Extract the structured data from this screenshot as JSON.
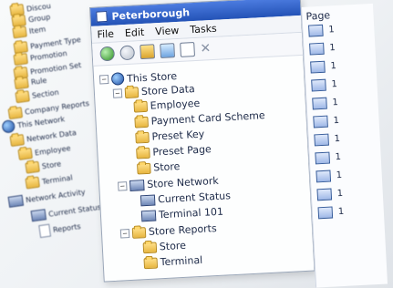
{
  "left_tree": {
    "items": [
      {
        "label": "Discou",
        "icon": "folder-icon"
      },
      {
        "label": "Group",
        "icon": "folder-icon"
      },
      {
        "label": "Item",
        "icon": "folder-icon"
      },
      {
        "label": "Payment Type",
        "icon": "folder-icon"
      },
      {
        "label": "Promotion",
        "icon": "folder-icon"
      },
      {
        "label": "Promotion Set",
        "icon": "folder-icon"
      },
      {
        "label": "Rule",
        "icon": "folder-icon"
      },
      {
        "label": "Section",
        "icon": "folder-icon"
      },
      {
        "label": "Company Reports",
        "icon": "folder-icon"
      },
      {
        "label": "This Network",
        "icon": "globe-icon"
      },
      {
        "label": "Network Data",
        "icon": "folder-icon"
      },
      {
        "label": "Employee",
        "icon": "folder-icon"
      },
      {
        "label": "Store",
        "icon": "folder-icon"
      },
      {
        "label": "Terminal",
        "icon": "folder-icon"
      },
      {
        "label": "Network Activity",
        "icon": "network-icon"
      },
      {
        "label": "Current Status",
        "icon": "network-icon"
      },
      {
        "label": "Reports",
        "icon": "document-icon"
      }
    ]
  },
  "window": {
    "title": "Peterborough",
    "menu": [
      "File",
      "Edit",
      "View",
      "Tasks"
    ],
    "tree": [
      {
        "label": "This Store",
        "icon": "globe-icon"
      },
      {
        "label": "Store Data",
        "icon": "folder-icon"
      },
      {
        "label": "Employee",
        "icon": "folder-icon"
      },
      {
        "label": "Payment Card Scheme",
        "icon": "folder-icon"
      },
      {
        "label": "Preset Key",
        "icon": "folder-icon"
      },
      {
        "label": "Preset Page",
        "icon": "folder-icon"
      },
      {
        "label": "Store",
        "icon": "folder-icon"
      },
      {
        "label": "Store Network",
        "icon": "network-icon"
      },
      {
        "label": "Current Status",
        "icon": "network-icon"
      },
      {
        "label": "Terminal 101",
        "icon": "network-icon"
      },
      {
        "label": "Store Reports",
        "icon": "folder-icon"
      },
      {
        "label": "Store",
        "icon": "folder-icon"
      },
      {
        "label": "Terminal",
        "icon": "folder-icon"
      }
    ]
  },
  "right_panel": {
    "header": "Page",
    "rows": [
      "1",
      "1",
      "1",
      "1",
      "1",
      "1",
      "1",
      "1",
      "1",
      "1",
      "1"
    ]
  }
}
